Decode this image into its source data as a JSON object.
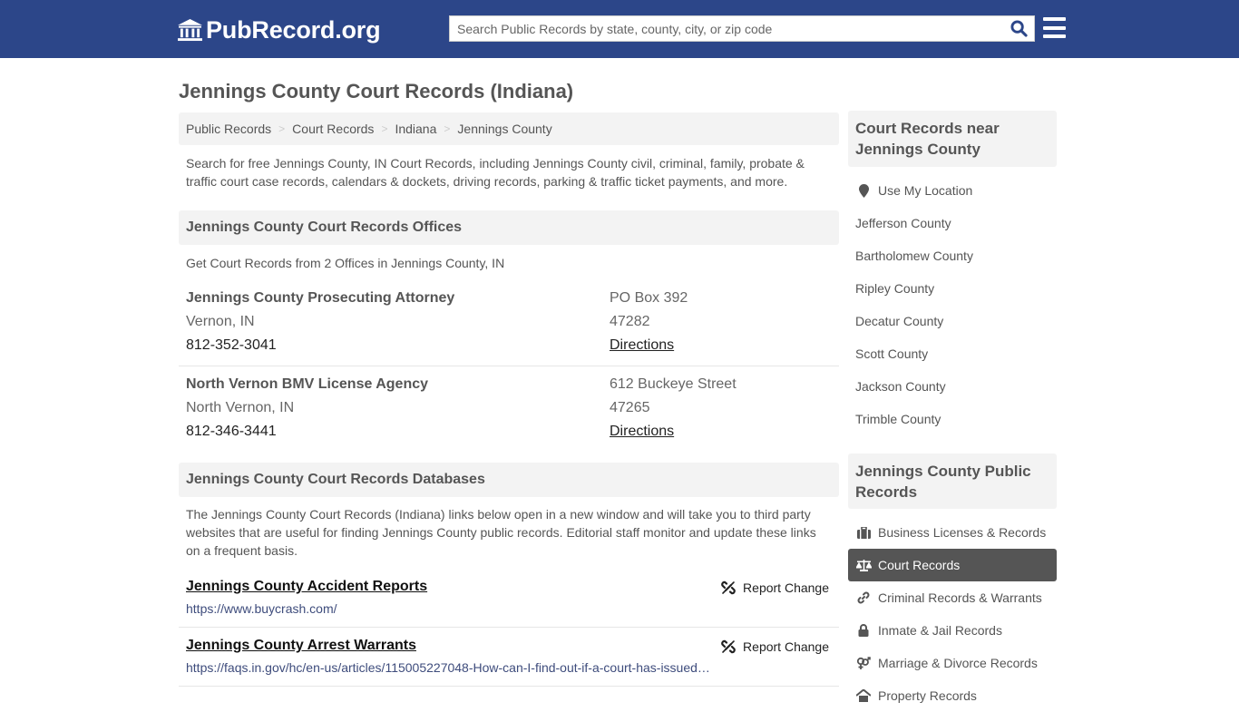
{
  "header": {
    "logo_text": "PubRecord.org",
    "search_placeholder": "Search Public Records by state, county, city, or zip code",
    "brand_color": "#2c4689"
  },
  "page_title": "Jennings County Court Records (Indiana)",
  "breadcrumb": [
    "Public Records",
    "Court Records",
    "Indiana",
    "Jennings County"
  ],
  "intro": "Search for free Jennings County, IN Court Records, including Jennings County civil, criminal, family, probate & traffic court case records, calendars & dockets, driving records, parking & traffic ticket payments, and more.",
  "offices_section": {
    "title": "Jennings County Court Records Offices",
    "subtitle": "Get Court Records from 2 Offices in Jennings County, IN",
    "offices": [
      {
        "name": "Jennings County Prosecuting Attorney",
        "city": "Vernon, IN",
        "phone": "812-352-3041",
        "address": "PO Box 392",
        "zip": "47282",
        "directions": "Directions"
      },
      {
        "name": "North Vernon BMV License Agency",
        "city": "North Vernon, IN",
        "phone": "812-346-3441",
        "address": "612 Buckeye Street",
        "zip": "47265",
        "directions": "Directions"
      }
    ]
  },
  "databases_section": {
    "title": "Jennings County Court Records Databases",
    "description": "The Jennings County Court Records (Indiana) links below open in a new window and will take you to third party websites that are useful for finding Jennings County public records. Editorial staff monitor and update these links on a frequent basis.",
    "report_label": "Report Change",
    "links": [
      {
        "title": "Jennings County Accident Reports",
        "url": "https://www.buycrash.com/"
      },
      {
        "title": "Jennings County Arrest Warrants",
        "url": "https://faqs.in.gov/hc/en-us/articles/115005227048-How-can-I-find-out-if-a-court-has-issued…"
      }
    ]
  },
  "sidebar": {
    "nearby_title": "Court Records near Jennings County",
    "use_location": "Use My Location",
    "nearby": [
      "Jefferson County",
      "Bartholomew County",
      "Ripley County",
      "Decatur County",
      "Scott County",
      "Jackson County",
      "Trimble County"
    ],
    "public_title": "Jennings County Public Records",
    "public_records": [
      {
        "label": "Business Licenses & Records",
        "icon": "briefcase-icon",
        "active": false
      },
      {
        "label": "Court Records",
        "icon": "scales-icon",
        "active": true
      },
      {
        "label": "Criminal Records & Warrants",
        "icon": "link-icon",
        "active": false
      },
      {
        "label": "Inmate & Jail Records",
        "icon": "lock-icon",
        "active": false
      },
      {
        "label": "Marriage & Divorce Records",
        "icon": "venus-mars-icon",
        "active": false
      },
      {
        "label": "Property Records",
        "icon": "home-icon",
        "active": false
      }
    ]
  }
}
